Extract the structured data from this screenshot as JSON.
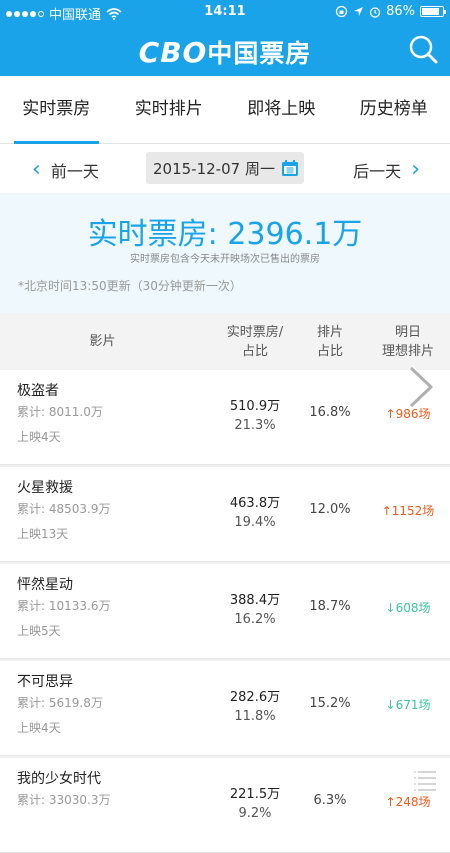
{
  "status": {
    "carrier": "中国联通",
    "time": "14:11",
    "battery": "86%",
    "battery_level": 0.86,
    "signal_bars": 4
  },
  "header": {
    "logo_en": "CBO",
    "logo_cn": "中国票房",
    "search_icon": "search-icon",
    "color": "#1aa3e8"
  },
  "tabs": [
    {
      "label": "实时票房",
      "active": true
    },
    {
      "label": "实时排片",
      "active": false
    },
    {
      "label": "即将上映",
      "active": false
    },
    {
      "label": "历史榜单",
      "active": false
    }
  ],
  "datebar": {
    "prev": "前一天",
    "date": "2015-12-07 周一",
    "next": "后一天"
  },
  "summary": {
    "headline": "实时票房: 2396.1万",
    "note": "实时票房包含今天未开映场次已售出的票房",
    "update": "*北京时间13:50更新（30分钟更新一次）"
  },
  "table": {
    "headers": {
      "film": "影片",
      "box_1": "实时票房/",
      "box_2": "占比",
      "share_1": "排片",
      "share_2": "占比",
      "ideal_1": "明日",
      "ideal_2": "理想排片"
    },
    "rows": [
      {
        "title": "极盗者",
        "cumulative": "累计: 8011.0万",
        "days": "上映4天",
        "box": "510.9万",
        "box_share": "21.3%",
        "screening": "16.8%",
        "ideal": "↑986场",
        "trend": "up"
      },
      {
        "title": "火星救援",
        "cumulative": "累计: 48503.9万",
        "days": "上映13天",
        "box": "463.8万",
        "box_share": "19.4%",
        "screening": "12.0%",
        "ideal": "↑1152场",
        "trend": "up"
      },
      {
        "title": "怦然星动",
        "cumulative": "累计: 10133.6万",
        "days": "上映5天",
        "box": "388.4万",
        "box_share": "16.2%",
        "screening": "18.7%",
        "ideal": "↓608场",
        "trend": "down"
      },
      {
        "title": "不可思异",
        "cumulative": "累计: 5619.8万",
        "days": "上映4天",
        "box": "282.6万",
        "box_share": "11.8%",
        "screening": "15.2%",
        "ideal": "↓671场",
        "trend": "down"
      },
      {
        "title": "我的少女时代",
        "cumulative": "累计: 33030.3万",
        "days": "",
        "box": "221.5万",
        "box_share": "9.2%",
        "screening": "6.3%",
        "ideal": "↑248场",
        "trend": "up"
      }
    ]
  }
}
